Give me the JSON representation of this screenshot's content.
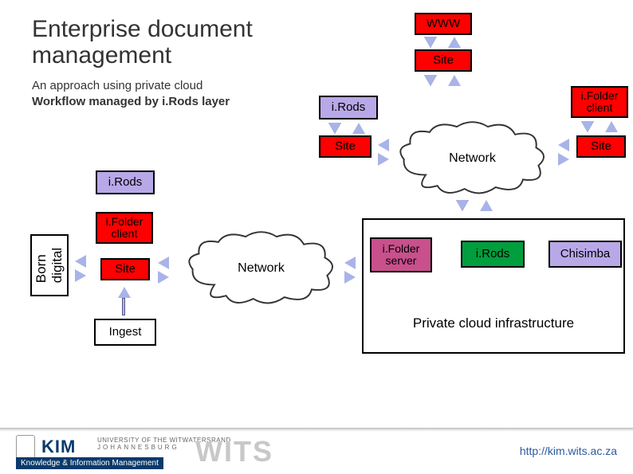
{
  "title_line1": "Enterprise document",
  "title_line2": "management",
  "subtitle_line1": "An approach using private cloud",
  "subtitle_line2": "Workflow managed by i.Rods layer",
  "labels": {
    "www": "WWW",
    "site": "Site",
    "irods": "i.Rods",
    "ifolder_client": "i.Folder client",
    "ifolder_server": "i.Folder\nserver",
    "network": "Network",
    "chisimba": "Chisimba",
    "ingest": "Ingest",
    "born_digital": "Born digital",
    "private_cloud": "Private cloud infrastructure"
  },
  "footer": {
    "kim": "KIM",
    "sub": "Knowledge & Information Management",
    "univ": "UNIVERSITY OF THE WITWATERSRAND",
    "city": "JOHANNESBURG",
    "wits": "WITS",
    "url": "http://kim.wits.ac.za"
  }
}
